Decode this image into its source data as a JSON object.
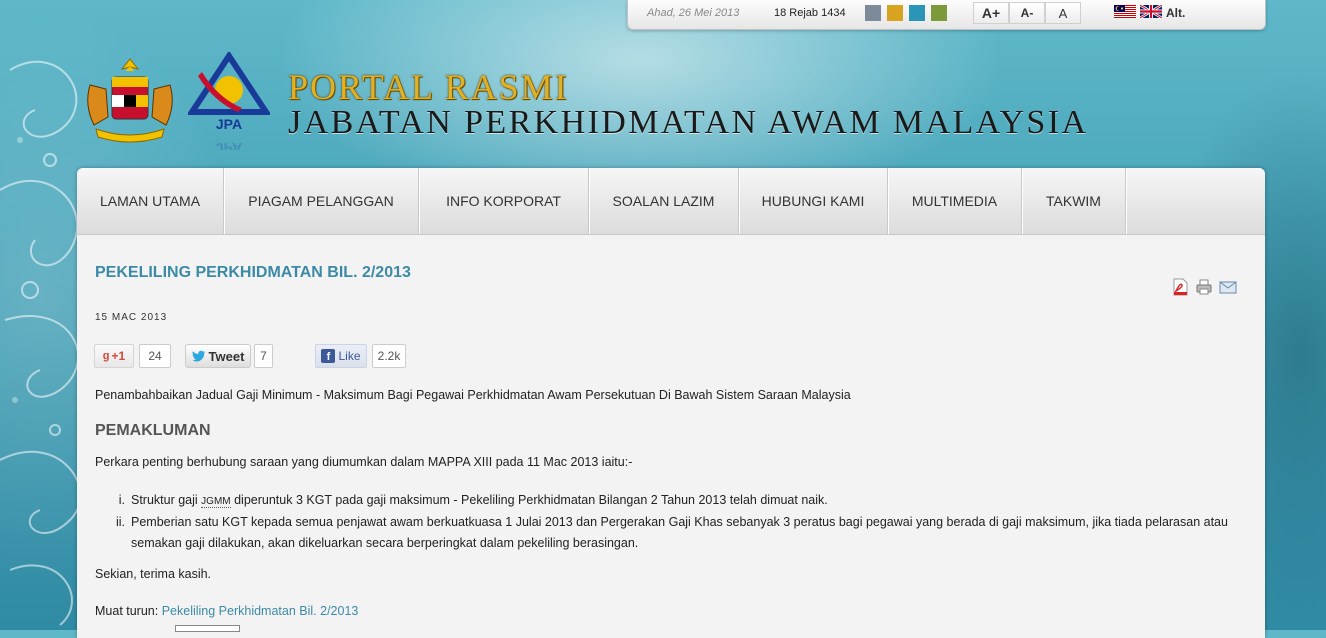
{
  "util_bar": {
    "date": "Ahad, 26 Mei 2013",
    "hijri_date": "18 Rejab 1434",
    "theme_colors": [
      "#7d8a99",
      "#d8a320",
      "#2b95b8",
      "#7c9a3a"
    ],
    "font_buttons": [
      "A+",
      "A-",
      "A"
    ],
    "alt_label": "Alt."
  },
  "header": {
    "title_line1": "PORTAL RASMI",
    "title_line2": "JABATAN PERKHIDMATAN AWAM MALAYSIA",
    "logo_text": "JPA"
  },
  "nav": {
    "items": [
      {
        "label": "LAMAN UTAMA",
        "w": 146
      },
      {
        "label": "PIAGAM PELANGGAN",
        "w": 194
      },
      {
        "label": "INFO KORPORAT",
        "w": 169
      },
      {
        "label": "SOALAN LAZIM",
        "w": 149
      },
      {
        "label": "HUBUNGI KAMI",
        "w": 148
      },
      {
        "label": "MULTIMEDIA",
        "w": 133
      },
      {
        "label": "TAKWIM",
        "w": 103
      }
    ]
  },
  "article": {
    "title": "PEKELILING PERKHIDMATAN BIL. 2/2013",
    "date": "15 MAC 2013",
    "social": {
      "gplus_label": "+1",
      "gplus_count": "24",
      "tweet_label": "Tweet",
      "tweet_count": "7",
      "like_label": "Like",
      "like_count": "2.2k"
    },
    "subtitle": "Penambahbaikan Jadual Gaji Minimum - Maksimum Bagi Pegawai Perkhidmatan Awam Persekutuan Di Bawah Sistem Saraan Malaysia",
    "heading": "PEMAKLUMAN",
    "intro": "Perkara penting berhubung saraan yang diumumkan dalam MAPPA XIII pada 11 Mac 2013 iaitu:-",
    "list": [
      {
        "num": "i.",
        "pre": "Struktur gaji ",
        "abbr": "JGMM",
        "post": " diperuntuk 3 KGT pada gaji maksimum - Pekeliling Perkhidmatan Bilangan 2 Tahun 2013 telah dimuat naik."
      },
      {
        "num": "ii.",
        "pre": "Pemberian satu KGT kepada semua penjawat awam berkuatkuasa 1 Julai 2013 dan Pergerakan Gaji Khas sebanyak 3 peratus bagi pegawai yang berada di gaji maksimum, jika tiada pelarasan atau semakan gaji dilakukan, akan dikeluarkan secara berperingkat dalam pekeliling berasingan.",
        "abbr": "",
        "post": ""
      }
    ],
    "closing": "Sekian, terima kasih.",
    "download_label": "Muat turun: ",
    "download_link": "Pekeliling Perkhidmatan Bil. 2/2013"
  }
}
